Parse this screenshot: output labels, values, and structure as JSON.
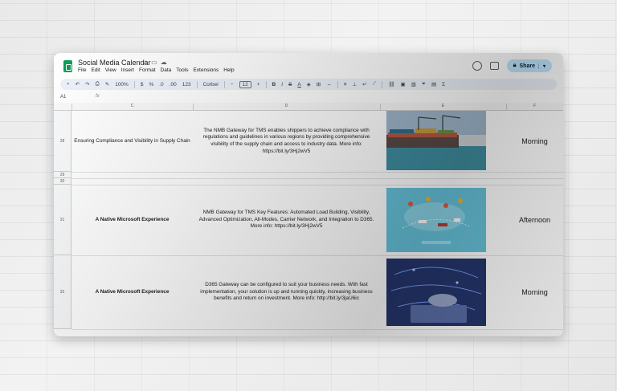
{
  "window": {
    "title": "Social Media Calendar"
  },
  "menu": [
    "File",
    "Edit",
    "View",
    "Insert",
    "Format",
    "Data",
    "Tools",
    "Extensions",
    "Help"
  ],
  "share_label": "Share",
  "toolbar": {
    "zoom": "100%",
    "currency": "$",
    "percent": "%",
    "decimals": ".0",
    "decimals_more": ".00",
    "format_more": "123",
    "font": "Corbel",
    "font_size": "12",
    "bold": "B",
    "italic": "I",
    "strike": "S"
  },
  "formula": {
    "cell_ref": "A1",
    "fx": "fx"
  },
  "columns": [
    "C",
    "D",
    "E",
    "F"
  ],
  "rows": [
    {
      "num": "28",
      "title": "Ensuring Compliance and Visibility in Supply Chain",
      "title_bold": false,
      "body": "The NMB Gateway for TMS enables shippers to achieve compliance with regulations and guidelines in various regions by providing comprehensive visibility of the supply chain and access to industry data. More info: https://bit.ly/3Hj2wV5",
      "image": "container-ship-port-image",
      "time": "Morning"
    },
    {
      "num": "29"
    },
    {
      "num": "30"
    },
    {
      "num": "31",
      "title": "A Native Microsoft Experience",
      "title_bold": true,
      "body": "NMB Gateway for TMS Key Features: Automated Load Building, Visibility, Advanced Optimization, All-Modes, Carrier Network, and Integration to D365. More info: https://bit.ly/3Hj2wV5",
      "image": "logistics-map-image",
      "time": "Afternoon"
    },
    {
      "num": "32",
      "title": "A Native Microsoft Experience",
      "title_bold": true,
      "body": "D365 Gateway can be configured to suit your business needs. With fast implementation, your solution is up and running quickly, increasing business benefits and return on investment. More info: http://bit.ly/3jaU6ic",
      "image": "laptop-network-image",
      "time": "Morning"
    }
  ]
}
